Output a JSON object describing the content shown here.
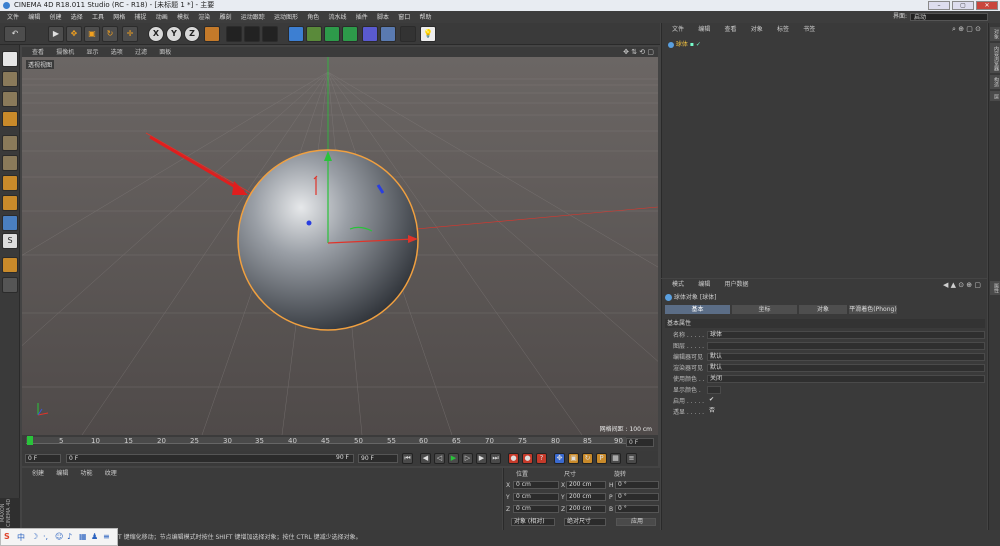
{
  "window": {
    "title": "CINEMA 4D R18.011 Studio (RC - R18) - [未标题 1 *] - 主要",
    "buttons": [
      "–",
      "▢",
      "✕"
    ]
  },
  "menubar": {
    "items": [
      "文件",
      "编辑",
      "创建",
      "选择",
      "工具",
      "网格",
      "捕捉",
      "动画",
      "模拟",
      "渲染",
      "雕刻",
      "运动跟踪",
      "运动图形",
      "角色",
      "流水线",
      "插件",
      "脚本",
      "窗口",
      "帮助"
    ],
    "layout_label": "界面:",
    "layout_value": "启动"
  },
  "toolbar": {
    "undo": "↶",
    "tools": [
      "▶",
      "✥",
      "▣",
      "↻",
      "✛"
    ],
    "axes": [
      "X",
      "Y",
      "Z"
    ]
  },
  "viewport": {
    "menu": [
      "查看",
      "摄像机",
      "显示",
      "选项",
      "过滤",
      "面板"
    ],
    "label": "透视视图",
    "grid_info": "网格间距 : 100 cm"
  },
  "timeline": {
    "ticks": [
      "0",
      "5",
      "10",
      "15",
      "20",
      "25",
      "30",
      "35",
      "40",
      "45",
      "50",
      "55",
      "60",
      "65",
      "70",
      "75",
      "80",
      "85",
      "90"
    ],
    "end_label": "0 F"
  },
  "transport": {
    "start": "0 F",
    "cur": "0 F",
    "end1": "90 F",
    "end2": "90 F"
  },
  "material": {
    "menu": [
      "创建",
      "编辑",
      "功能",
      "纹理"
    ]
  },
  "coords": {
    "headers": [
      "位置",
      "尺寸",
      "旋转"
    ],
    "pos": [
      "0 cm",
      "0 cm",
      "0 cm"
    ],
    "size": [
      "200 cm",
      "200 cm",
      "200 cm"
    ],
    "rot": [
      "0 °",
      "0 °",
      "0 °"
    ],
    "axes": [
      "X",
      "Y",
      "Z"
    ],
    "rot_axes": [
      "H",
      "P",
      "B"
    ],
    "mode": "对象 (相对)",
    "size_mode": "绝对尺寸",
    "apply": "应用"
  },
  "objects": {
    "menu": [
      "文件",
      "编辑",
      "查看",
      "对象",
      "标签",
      "书签"
    ],
    "item": "球体"
  },
  "attributes": {
    "menu": [
      "模式",
      "编辑",
      "用户数据"
    ],
    "title": "球体对象 [球体]",
    "tabs": [
      "基本",
      "坐标",
      "对象",
      "平滑着色(Phong)"
    ],
    "section": "基本属性",
    "rows": [
      {
        "label": "名称 . . . . .",
        "value": "球体"
      },
      {
        "label": "图层 . . . . .",
        "value": ""
      },
      {
        "label": "编辑器可见",
        "value": "默认"
      },
      {
        "label": "渲染器可见",
        "value": "默认"
      },
      {
        "label": "使用颜色 . .",
        "value": "关闭"
      },
      {
        "label": "显示颜色 .",
        "value": ""
      },
      {
        "label": "启用 . . . . .",
        "value": "✔"
      },
      {
        "label": "透显 . . . . .",
        "value": "否"
      }
    ]
  },
  "status": {
    "text": "T 键缩化移动；节点编辑模式时按住 SHIFT 键增加选择对象；按住 CTRL 键减少选择对象。"
  },
  "side_tabs": [
    "对象",
    "内容浏览器",
    "构造",
    "层",
    "属性"
  ],
  "brand": "MAXON CINEMA 4D",
  "colors": {
    "accent": "#5b6d86",
    "x_axis": "#e0342a",
    "y_axis": "#29c33a",
    "z_axis": "#3a55d8"
  }
}
